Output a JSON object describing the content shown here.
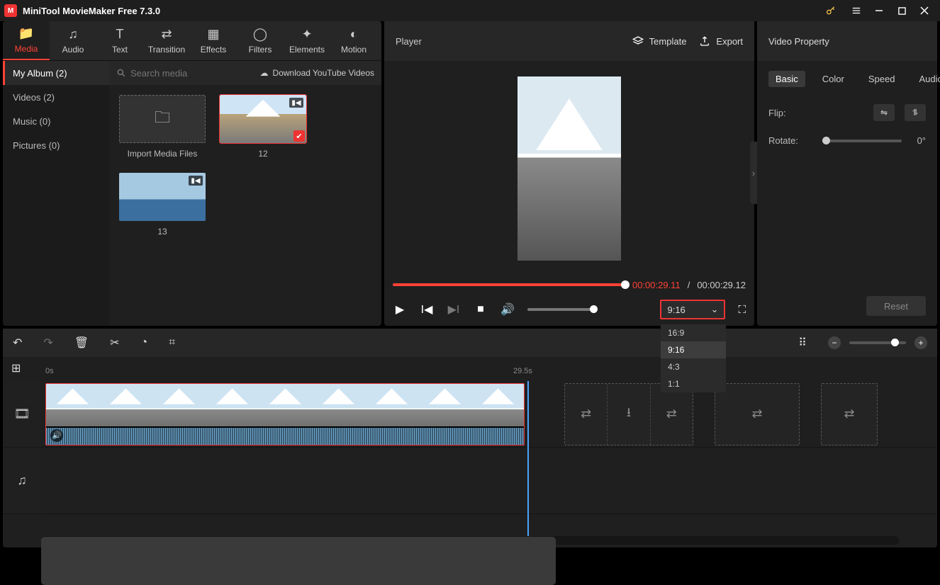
{
  "app": {
    "title": "MiniTool MovieMaker Free 7.3.0"
  },
  "tabs": [
    {
      "label": "Media"
    },
    {
      "label": "Audio"
    },
    {
      "label": "Text"
    },
    {
      "label": "Transition"
    },
    {
      "label": "Effects"
    },
    {
      "label": "Filters"
    },
    {
      "label": "Elements"
    },
    {
      "label": "Motion"
    }
  ],
  "sidebar": {
    "items": [
      {
        "label": "My Album (2)"
      },
      {
        "label": "Videos (2)"
      },
      {
        "label": "Music (0)"
      },
      {
        "label": "Pictures (0)"
      }
    ]
  },
  "search": {
    "placeholder": "Search media",
    "yt": "Download YouTube Videos"
  },
  "media": {
    "import_label": "Import Media Files",
    "items": [
      {
        "name": "12"
      },
      {
        "name": "13"
      }
    ]
  },
  "player": {
    "title": "Player",
    "template": "Template",
    "export": "Export",
    "time_current": "00:00:29.11",
    "time_total": "00:00:29.12",
    "ratio_selected": "9:16",
    "ratio_options": [
      "16:9",
      "9:16",
      "4:3",
      "1:1"
    ]
  },
  "props": {
    "title": "Video Property",
    "tabs": [
      "Basic",
      "Color",
      "Speed",
      "Audio"
    ],
    "flip_label": "Flip:",
    "rotate_label": "Rotate:",
    "rotate_value": "0°",
    "reset": "Reset"
  },
  "timeline": {
    "start": "0s",
    "mark": "29.5s"
  }
}
